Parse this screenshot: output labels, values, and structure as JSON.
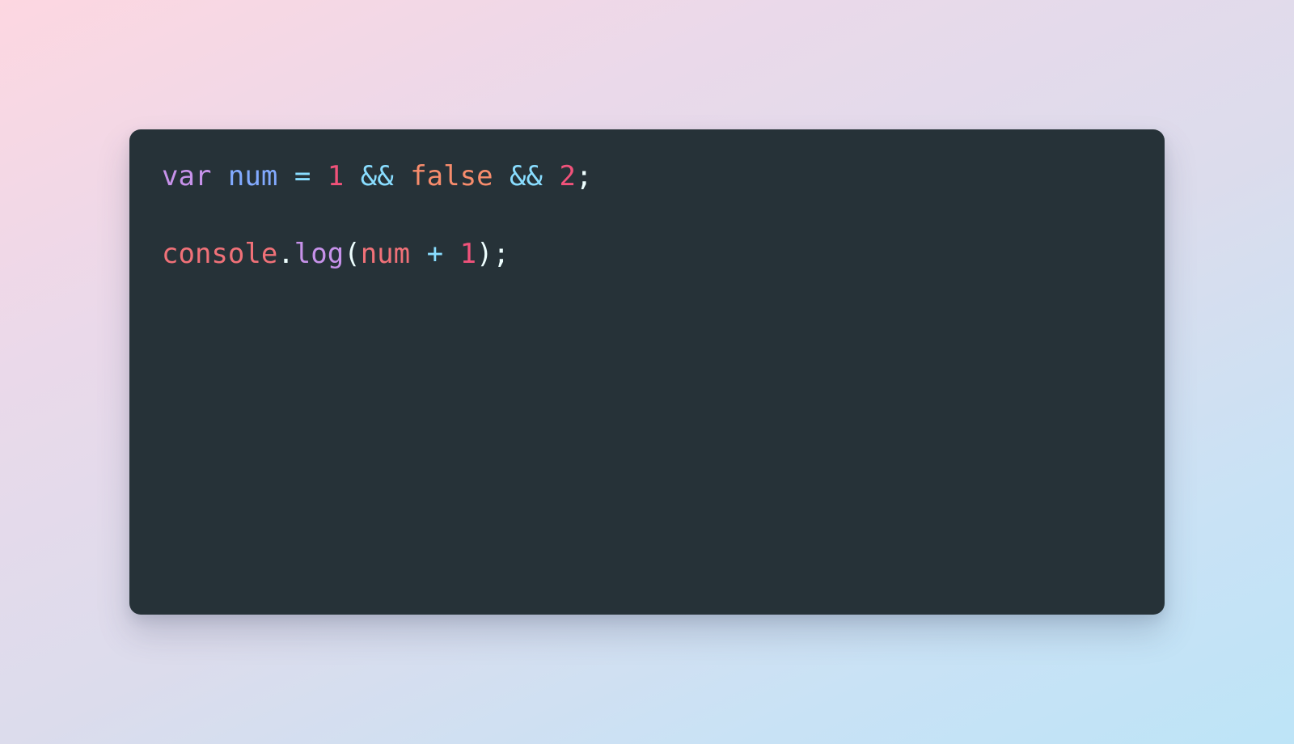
{
  "colors": {
    "keyword": "#c792ea",
    "variable": "#82aaff",
    "operator": "#89ddff",
    "number": "#f0527a",
    "boolean": "#f78c6c",
    "punctuation": "#eeffff",
    "object": "#f07178",
    "method": "#c792ea",
    "background": "#263238"
  },
  "code": {
    "line1": {
      "t1": "var",
      "t2": " ",
      "t3": "num",
      "t4": " ",
      "t5": "=",
      "t6": " ",
      "t7": "1",
      "t8": " ",
      "t9": "&&",
      "t10": " ",
      "t11": "false",
      "t12": " ",
      "t13": "&&",
      "t14": " ",
      "t15": "2",
      "t16": ";"
    },
    "line3": {
      "t1": "console",
      "t2": ".",
      "t3": "log",
      "t4": "(",
      "t5": "num",
      "t6": " ",
      "t7": "+",
      "t8": " ",
      "t9": "1",
      "t10": ")",
      "t11": ";"
    }
  }
}
